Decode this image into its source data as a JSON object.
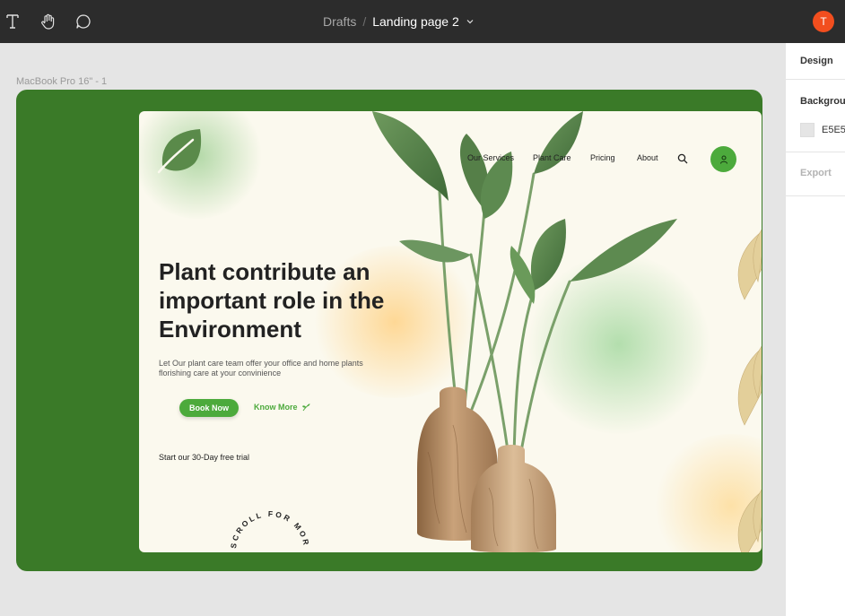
{
  "toolbar": {
    "tools": [
      {
        "icon": "text-tool-icon"
      },
      {
        "icon": "hand-tool-icon"
      },
      {
        "icon": "comment-icon"
      }
    ],
    "breadcrumb": {
      "parent": "Drafts",
      "separator": "/",
      "file": "Landing page 2"
    },
    "user_initial": "T",
    "avatar_color": "#f24e1e"
  },
  "right_panel": {
    "tab": "Design",
    "background_label": "Backgrou",
    "background_hex": "E5E5",
    "export_label": "Export"
  },
  "canvas": {
    "frame_label": "MacBook Pro 16\" - 1",
    "background_color": "#e5e5e5",
    "frame_color": "#3a7a28"
  },
  "landing": {
    "nav": [
      "Our Services",
      "Plant Care",
      "Pricing",
      "About"
    ],
    "headline": "Plant contribute an important role in the Environment",
    "subtext": "Let Our plant care team offer your office and home plants florishing care at your convinience",
    "book_button": "Book Now",
    "know_more": "Know More",
    "trial": "Start our 30-Day free trial",
    "scroll_text": "SCROLL FOR MORE INFO",
    "accent_color": "#4caa3c"
  }
}
